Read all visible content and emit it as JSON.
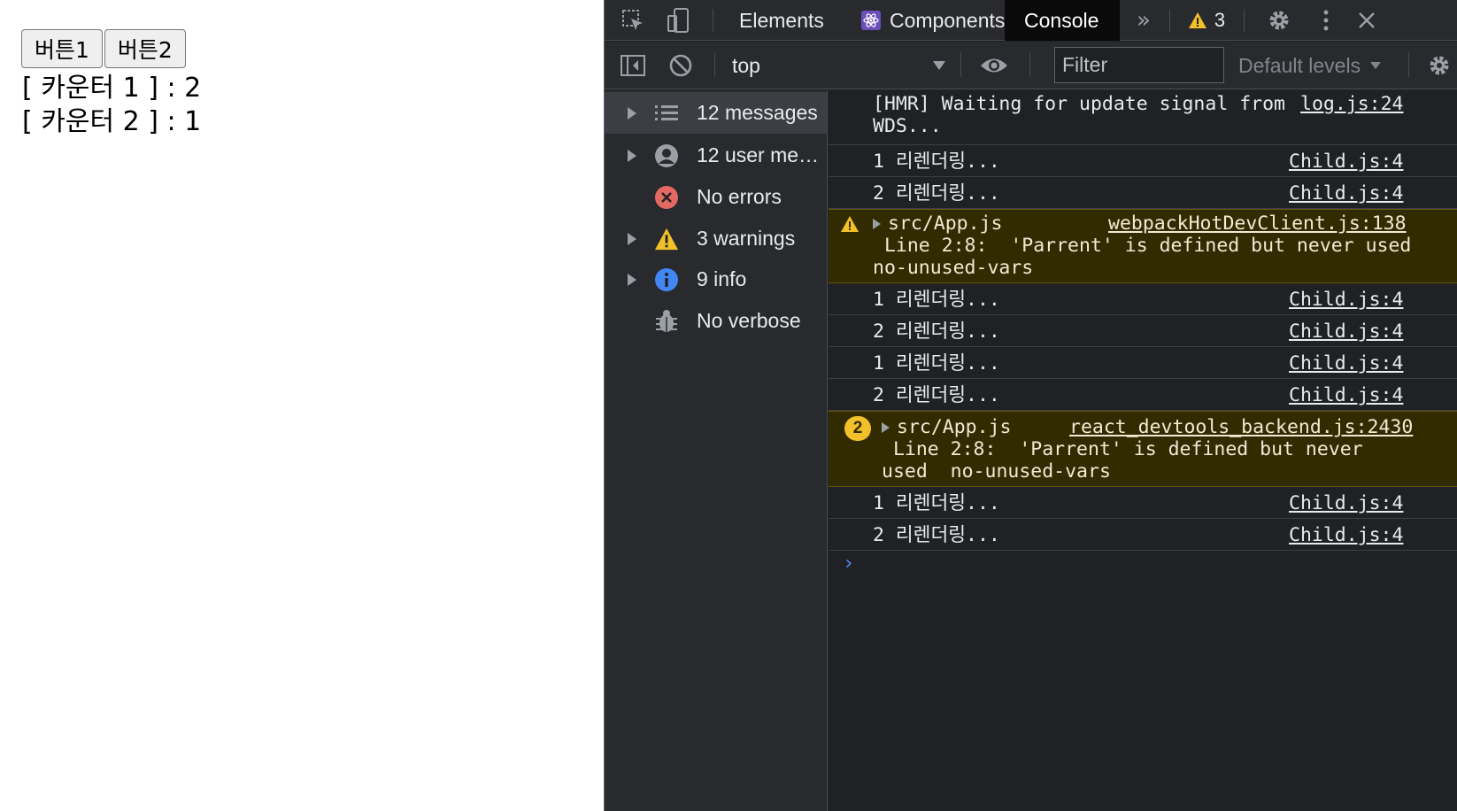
{
  "app": {
    "buttons": [
      "버튼1",
      "버튼2"
    ],
    "counters": [
      "[ 카운터 1 ] : 2",
      "[ 카운터 2 ] : 1"
    ]
  },
  "devtools": {
    "tabs": [
      "Elements",
      "Components",
      "Console"
    ],
    "active_tab": "Console",
    "more_tabs_icon": "chevron-double-right-icon",
    "warning_count": "3",
    "toolbar": {
      "context": "top",
      "filter_placeholder": "Filter",
      "levels": "Default levels"
    },
    "sidebar": [
      {
        "label": "12 messages",
        "icon": "list-icon"
      },
      {
        "label": "12 user me…",
        "icon": "user-icon"
      },
      {
        "label": "No errors",
        "icon": "error-icon"
      },
      {
        "label": "3 warnings",
        "icon": "warning-icon"
      },
      {
        "label": "9 info",
        "icon": "info-icon"
      },
      {
        "label": "No verbose",
        "icon": "bug-icon"
      }
    ],
    "messages": [
      {
        "text": "[HMR] Waiting for update signal from\nWDS...",
        "source": "log.js:24"
      },
      {
        "text": "1 리렌더링...",
        "source": "Child.js:4"
      },
      {
        "text": "2 리렌더링...",
        "source": "Child.js:4"
      },
      {
        "text": "src/App.js",
        "detail": " Line 2:8:  'Parrent' is defined but never used\nno-unused-vars",
        "source": "webpackHotDevClient.js:138"
      },
      {
        "text": "1 리렌더링...",
        "source": "Child.js:4"
      },
      {
        "text": "2 리렌더링...",
        "source": "Child.js:4"
      },
      {
        "text": "1 리렌더링...",
        "source": "Child.js:4"
      },
      {
        "text": "2 리렌더링...",
        "source": "Child.js:4"
      },
      {
        "text": "src/App.js",
        "detail": " Line 2:8:  'Parrent' is defined but never\nused  no-unused-vars",
        "source": "react_devtools_backend.js:2430",
        "repeat": "2"
      },
      {
        "text": "1 리렌더링...",
        "source": "Child.js:4"
      },
      {
        "text": "2 리렌더링...",
        "source": "Child.js:4"
      }
    ]
  }
}
